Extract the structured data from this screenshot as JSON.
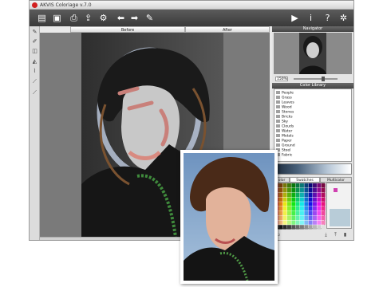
{
  "app": {
    "title": "AKVIS Coloriage v.7.0"
  },
  "tabs": {
    "before": "Before",
    "after": "After"
  },
  "navigator": {
    "title": "Navigator",
    "zoom": "150%"
  },
  "library": {
    "title": "Color Library",
    "items": [
      "People",
      "Grass",
      "Leaves",
      "Wood",
      "Stones",
      "Bricks",
      "Sky",
      "Clouds",
      "Water",
      "Metals",
      "Paper",
      "Ground",
      "Steel",
      "Fabric"
    ]
  },
  "swatches": {
    "tabs": [
      "olor",
      "Swatches",
      "Multicolor"
    ]
  },
  "colors": {
    "accent": "#d22020",
    "toolbar": "#444444",
    "panel_header": "#555555"
  }
}
